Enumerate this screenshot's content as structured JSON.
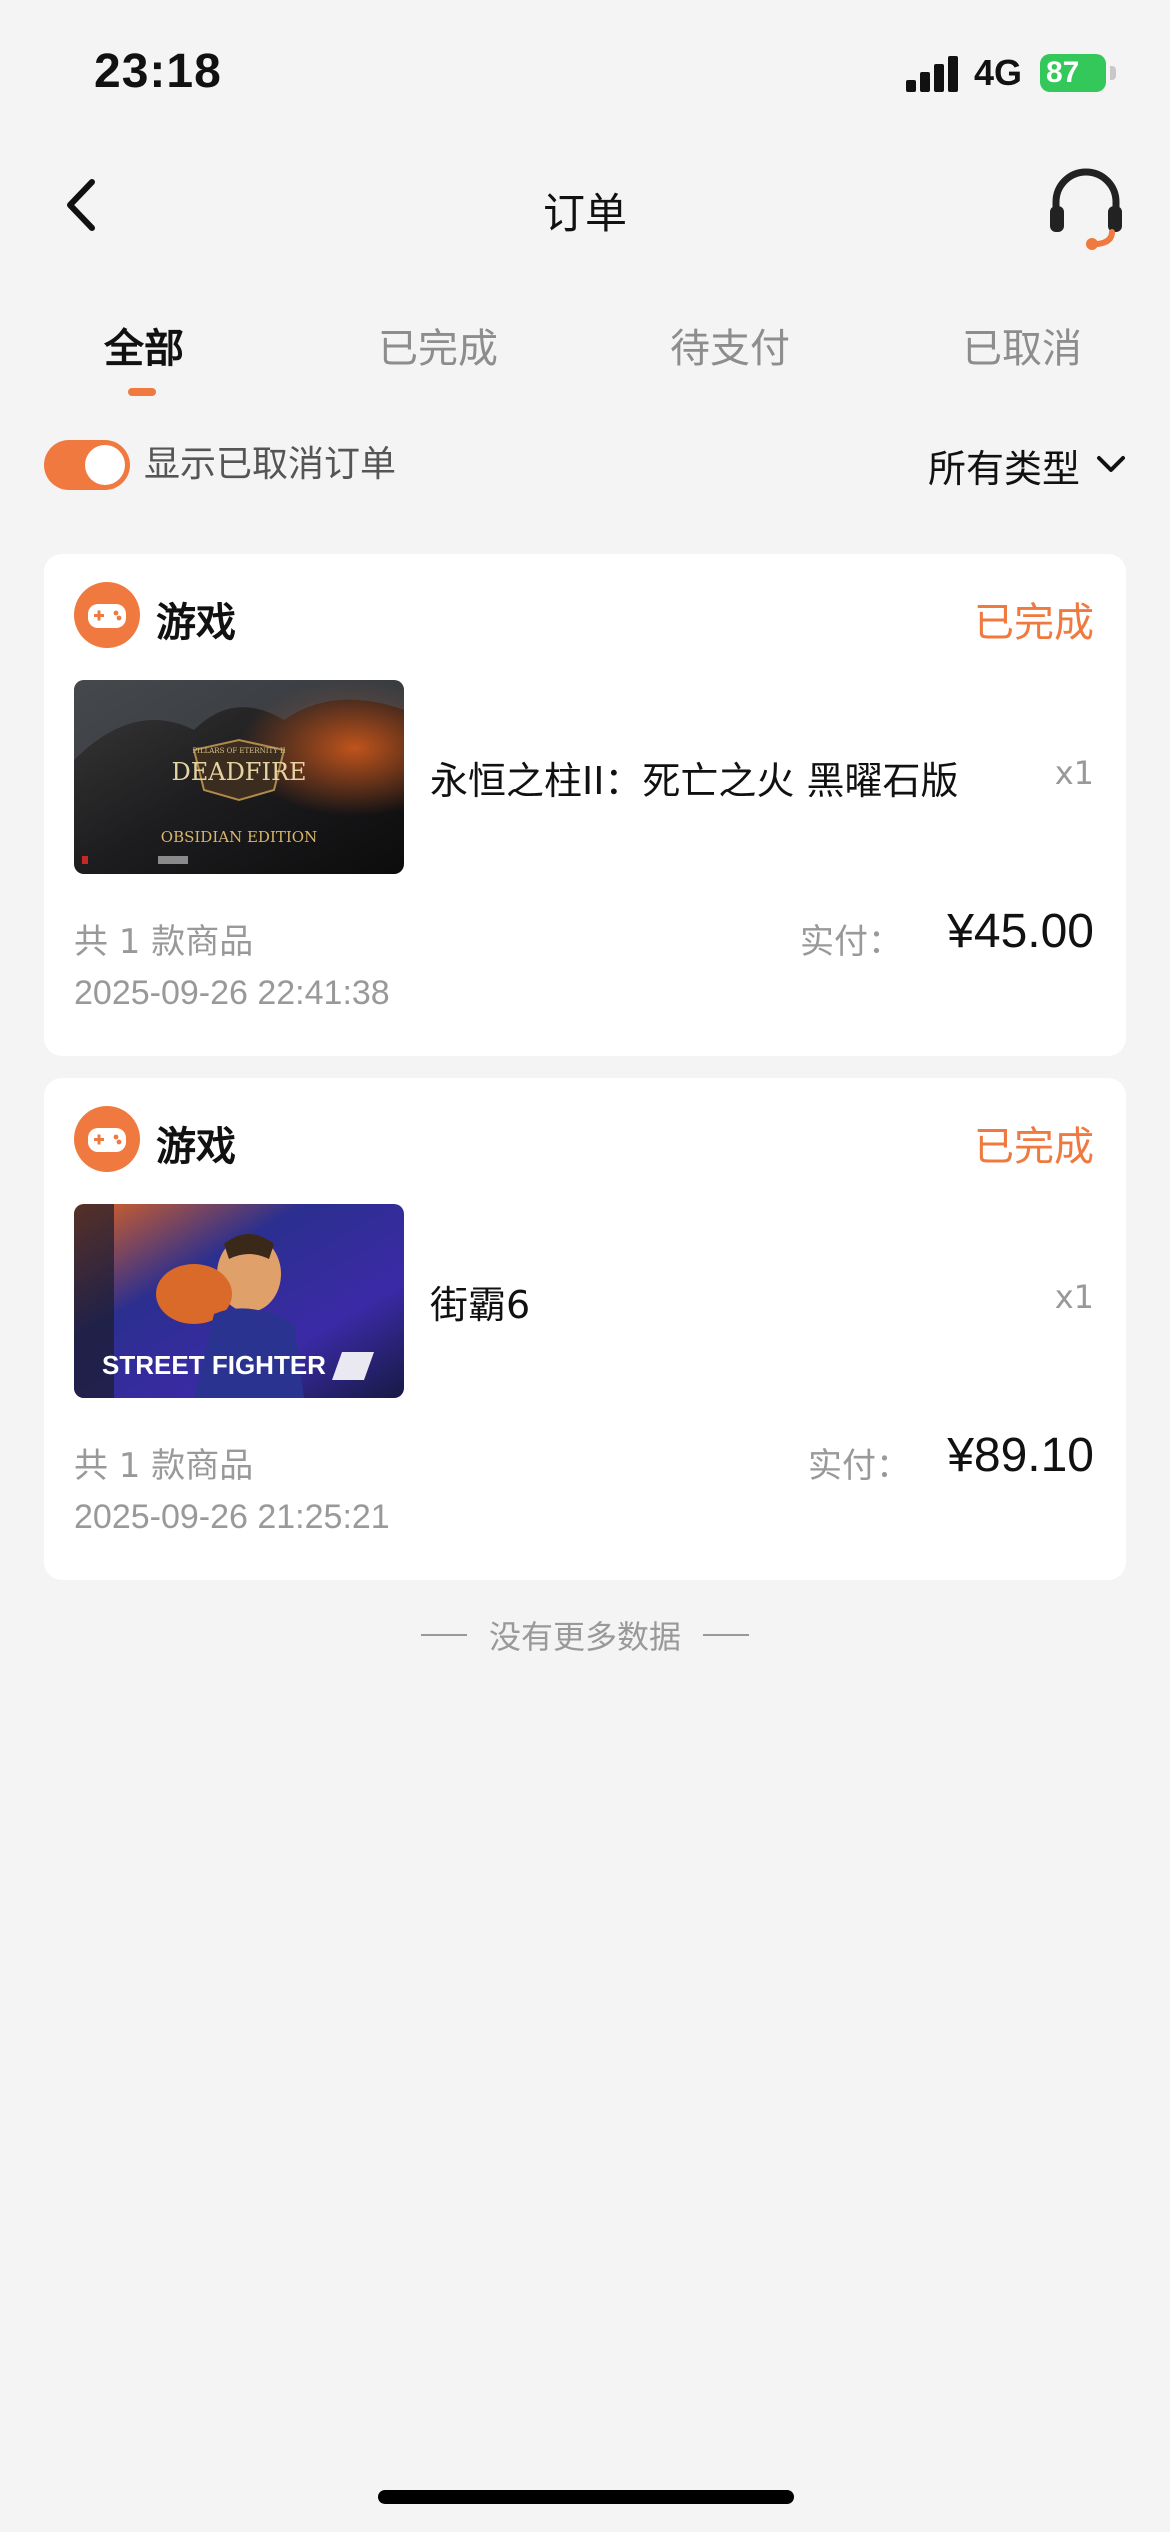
{
  "status_bar": {
    "time": "23:18",
    "network": "4G",
    "battery": "87"
  },
  "nav": {
    "title": "订单",
    "back_icon": "chevron-left-icon",
    "support_icon": "headset-icon"
  },
  "tabs": [
    {
      "label": "全部",
      "active": true
    },
    {
      "label": "已完成",
      "active": false
    },
    {
      "label": "待支付",
      "active": false
    },
    {
      "label": "已取消",
      "active": false
    }
  ],
  "filter": {
    "show_cancelled_label": "显示已取消订单",
    "show_cancelled_on": true,
    "type_label": "所有类型"
  },
  "orders": [
    {
      "category": "游戏",
      "status": "已完成",
      "product_name": "永恒之柱II：死亡之火 黑曜石版",
      "quantity": "x1",
      "item_count": "共 1 款商品",
      "pay_label": "实付：",
      "amount": "¥45.00",
      "date": "2025-09-26 22:41:38",
      "thumb_title": "DEADFIRE",
      "thumb_top": "PILLARS OF ETERNITY II",
      "thumb_sub": "OBSIDIAN EDITION"
    },
    {
      "category": "游戏",
      "status": "已完成",
      "product_name": "街霸6",
      "quantity": "x1",
      "item_count": "共 1 款商品",
      "pay_label": "实付：",
      "amount": "¥89.10",
      "date": "2025-09-26 21:25:21",
      "thumb_title": "STREET FIGHTER"
    }
  ],
  "footer": {
    "no_more": "没有更多数据"
  },
  "colors": {
    "accent": "#f0793f",
    "background": "#f4f4f4",
    "card": "#ffffff",
    "battery": "#34c759"
  }
}
